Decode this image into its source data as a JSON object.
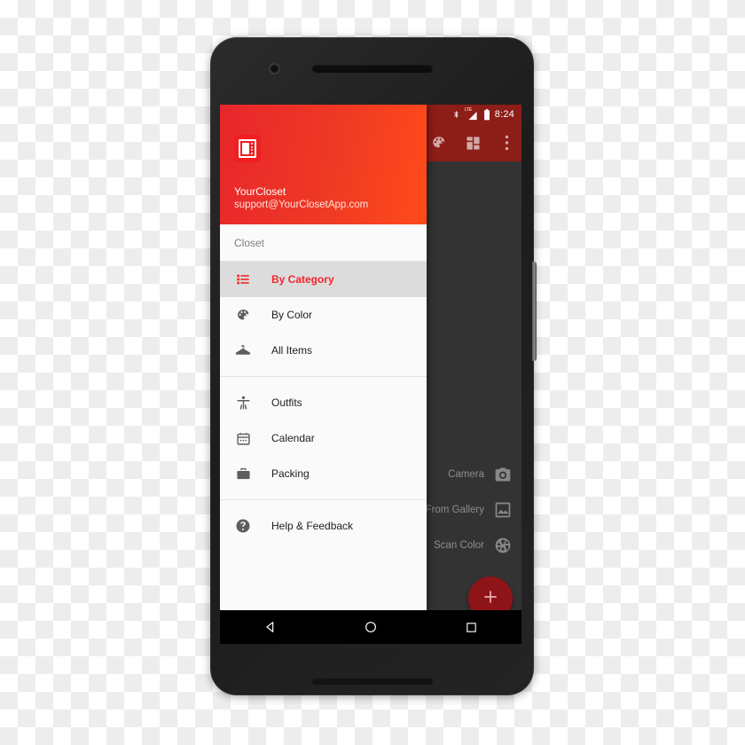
{
  "status_bar": {
    "time": "8:24",
    "icons": [
      "bluetooth-icon",
      "lte-signal-icon",
      "battery-icon"
    ],
    "lte_label": "LTE",
    "background_color": "#8c1d17"
  },
  "app_bar": {
    "icons": [
      "palette-icon",
      "grid-view-icon",
      "overflow-menu-icon"
    ],
    "background_color": "#8c1d17"
  },
  "drawer": {
    "header": {
      "app_name": "YourCloset",
      "email": "support@YourClosetApp.com",
      "logo_icon": "app-logo-icon",
      "gradient_from": "#e8262c",
      "gradient_to": "#ff4b1a"
    },
    "section_label": "Closet",
    "closet_items": [
      {
        "label": "By Category",
        "icon": "list-icon",
        "active": true
      },
      {
        "label": "By Color",
        "icon": "palette-icon",
        "active": false
      },
      {
        "label": "All Items",
        "icon": "hanger-icon",
        "active": false
      }
    ],
    "planning_items": [
      {
        "label": "Outfits",
        "icon": "person-icon",
        "active": false
      },
      {
        "label": "Calendar",
        "icon": "calendar-icon",
        "active": false
      },
      {
        "label": "Packing",
        "icon": "suitcase-icon",
        "active": false
      }
    ],
    "support_items": [
      {
        "label": "Help & Feedback",
        "icon": "help-circle-icon",
        "active": false
      }
    ],
    "accent_color": "#f0262c",
    "active_background": "#dcdcdc"
  },
  "speed_dial": {
    "actions": [
      {
        "label": "Camera",
        "icon": "camera-icon"
      },
      {
        "label": "From Gallery",
        "icon": "gallery-icon"
      },
      {
        "label": "Scan Color",
        "icon": "aperture-icon"
      }
    ],
    "fab": {
      "icon": "plus-icon",
      "color": "#8f1418"
    }
  },
  "navigation_bar": {
    "buttons": [
      {
        "name": "back",
        "icon": "back-triangle-icon"
      },
      {
        "name": "home",
        "icon": "home-circle-icon"
      },
      {
        "name": "recents",
        "icon": "recents-square-icon"
      }
    ]
  }
}
